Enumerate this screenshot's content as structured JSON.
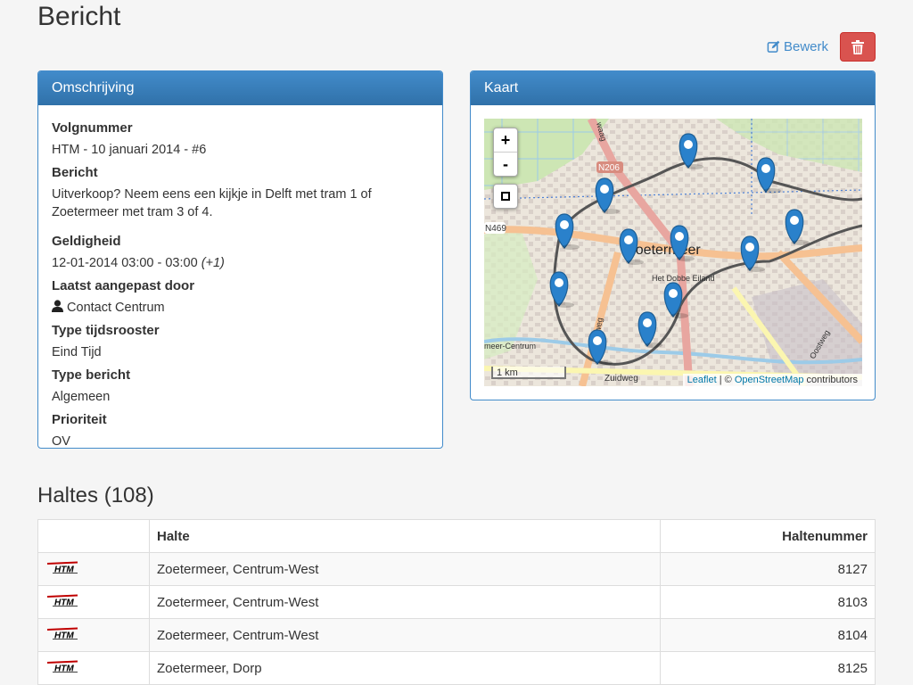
{
  "page": {
    "title": "Bericht"
  },
  "actions": {
    "edit_label": "Bewerk",
    "edit_icon": "edit-icon",
    "delete_icon": "trash-icon"
  },
  "colors": {
    "primary": "#428bca",
    "danger": "#d9534f",
    "htm_red": "#c00000"
  },
  "details": {
    "heading": "Omschrijving",
    "fields": {
      "volgnummer": {
        "label": "Volgnummer",
        "value": "HTM - 10 januari 2014 - #6"
      },
      "bericht": {
        "label": "Bericht",
        "value": "Uitverkoop? Neem eens een kijkje in Delft met tram 1 of Zoetermeer met tram 3 of 4."
      },
      "geldigheid": {
        "label": "Geldigheid",
        "value": "12-01-2014 03:00 - 03:00",
        "note": "(+1)"
      },
      "aangepast": {
        "label": "Laatst aangepast door",
        "value": "Contact Centrum",
        "icon": "user-icon"
      },
      "tijdsrooster": {
        "label": "Type tijdsrooster",
        "value": "Eind Tijd"
      },
      "typebericht": {
        "label": "Type bericht",
        "value": "Algemeen"
      },
      "prioriteit": {
        "label": "Prioriteit",
        "value": "OV"
      }
    }
  },
  "map": {
    "heading": "Kaart",
    "zoom_in": "+",
    "zoom_out": "-",
    "scale_label": "1 km",
    "attribution": {
      "leaflet": "Leaflet",
      "sep": " | © ",
      "osm": "OpenStreetMap",
      "suffix": " contributors"
    },
    "place_labels": {
      "city": "Zoetermeer",
      "n206": "N206",
      "n469": "N469",
      "dobbe": "Het Dobbe Eiland",
      "zuidweg": "Zuidweg",
      "centrum": "meer-Centrum",
      "oostweg": "Oostweg",
      "weg": "weg",
      "waag": "waag"
    }
  },
  "stops": {
    "title": "Haltes (108)",
    "columns": [
      "",
      "Halte",
      "Haltenummer"
    ],
    "operator_logo": "HTM",
    "rows": [
      {
        "halte": "Zoetermeer, Centrum-West",
        "nummer": "8127"
      },
      {
        "halte": "Zoetermeer, Centrum-West",
        "nummer": "8103"
      },
      {
        "halte": "Zoetermeer, Centrum-West",
        "nummer": "8104"
      },
      {
        "halte": "Zoetermeer, Dorp",
        "nummer": "8125"
      }
    ]
  }
}
